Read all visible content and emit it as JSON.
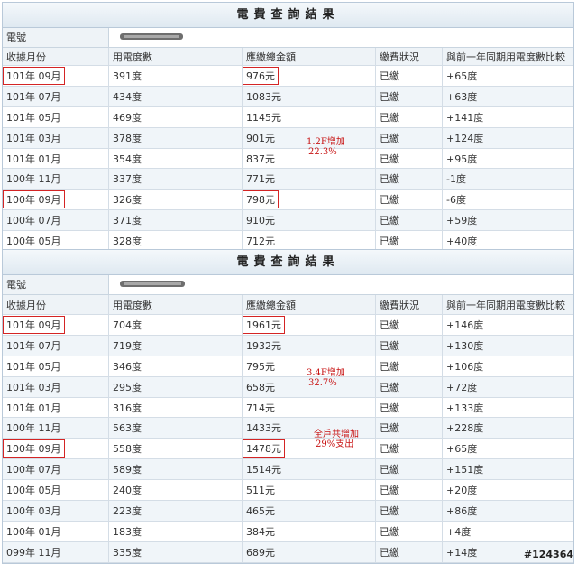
{
  "sections": [
    {
      "title": "電費查詢結果",
      "meter_label": "電號",
      "headers": [
        "收據月份",
        "用電度數",
        "應繳總金額",
        "繳費狀況",
        "與前一年同期用電度數比較"
      ],
      "rows": [
        [
          "101年 09月",
          "391度",
          "976元",
          "已繳",
          "+65度"
        ],
        [
          "101年 07月",
          "434度",
          "1083元",
          "已繳",
          "+63度"
        ],
        [
          "101年 05月",
          "469度",
          "1145元",
          "已繳",
          "+141度"
        ],
        [
          "101年 03月",
          "378度",
          "901元",
          "已繳",
          "+124度"
        ],
        [
          "101年 01月",
          "354度",
          "837元",
          "已繳",
          "+95度"
        ],
        [
          "100年 11月",
          "337度",
          "771元",
          "已繳",
          "-1度"
        ],
        [
          "100年 09月",
          "326度",
          "798元",
          "已繳",
          "-6度"
        ],
        [
          "100年 07月",
          "371度",
          "910元",
          "已繳",
          "+59度"
        ],
        [
          "100年 05月",
          "328度",
          "712元",
          "已繳",
          "+40度"
        ]
      ],
      "annotations": [
        {
          "line1": "1.2F增加",
          "line2": "22.3%"
        }
      ]
    },
    {
      "title": "電費查詢結果",
      "meter_label": "電號",
      "headers": [
        "收據月份",
        "用電度數",
        "應繳總金額",
        "繳費狀況",
        "與前一年同期用電度數比較"
      ],
      "rows": [
        [
          "101年 09月",
          "704度",
          "1961元",
          "已繳",
          "+146度"
        ],
        [
          "101年 07月",
          "719度",
          "1932元",
          "已繳",
          "+130度"
        ],
        [
          "101年 05月",
          "346度",
          "795元",
          "已繳",
          "+106度"
        ],
        [
          "101年 03月",
          "295度",
          "658元",
          "已繳",
          "+72度"
        ],
        [
          "101年 01月",
          "316度",
          "714元",
          "已繳",
          "+133度"
        ],
        [
          "100年 11月",
          "563度",
          "1433元",
          "已繳",
          "+228度"
        ],
        [
          "100年 09月",
          "558度",
          "1478元",
          "已繳",
          "+65度"
        ],
        [
          "100年 07月",
          "589度",
          "1514元",
          "已繳",
          "+151度"
        ],
        [
          "100年 05月",
          "240度",
          "511元",
          "已繳",
          "+20度"
        ],
        [
          "100年 03月",
          "223度",
          "465元",
          "已繳",
          "+86度"
        ],
        [
          "100年 01月",
          "183度",
          "384元",
          "已繳",
          "+4度"
        ],
        [
          "099年 11月",
          "335度",
          "689元",
          "已繳",
          "+14度"
        ]
      ],
      "annotations": [
        {
          "line1": "3.4F增加",
          "line2": "32.7%"
        },
        {
          "line1": "全戶共增加",
          "line2": "29%支出"
        }
      ]
    }
  ],
  "watermark": "#124364",
  "colors": {
    "highlight": "#d42424",
    "annotation": "#c81414",
    "header_bg": "#eef3f7"
  }
}
